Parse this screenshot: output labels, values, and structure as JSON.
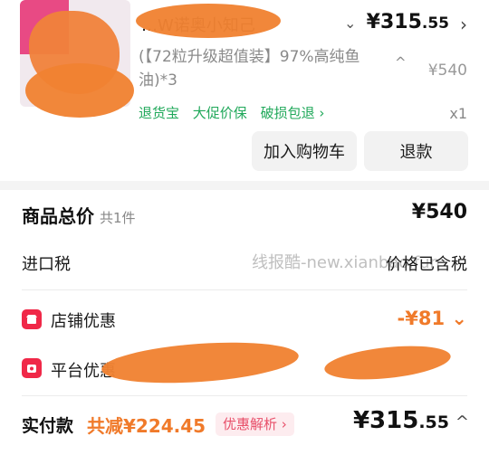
{
  "item": {
    "title": "…W诺奥小知己",
    "price_main": "¥315",
    "price_cents": ".55",
    "spec": "(【72粒升级超值装】97%高纯鱼油)*3",
    "original_price": "¥540",
    "services": [
      "退货宝",
      "大促价保",
      "破损包退 ›"
    ],
    "quantity": "x1",
    "add_to_cart": "加入购物车",
    "refund": "退款"
  },
  "summary": {
    "total_label": "商品总价",
    "total_count": "共1件",
    "total_value": "¥540",
    "tax_label": "进口税",
    "tax_value": "价格已含税",
    "watermark": "线报酷-new.xianbao.fun",
    "store_discount_label": "店铺优惠",
    "store_discount_value": "-¥81",
    "platform_discount_label": "平台优惠"
  },
  "payment": {
    "label": "实付款",
    "saving": "共减¥224.45",
    "detail_tag": "优惠解析 ›",
    "final_main": "¥315",
    "final_cents": ".55"
  },
  "colors": {
    "accent": "#f07a2a",
    "green": "#20a85a",
    "red": "#f02848"
  }
}
